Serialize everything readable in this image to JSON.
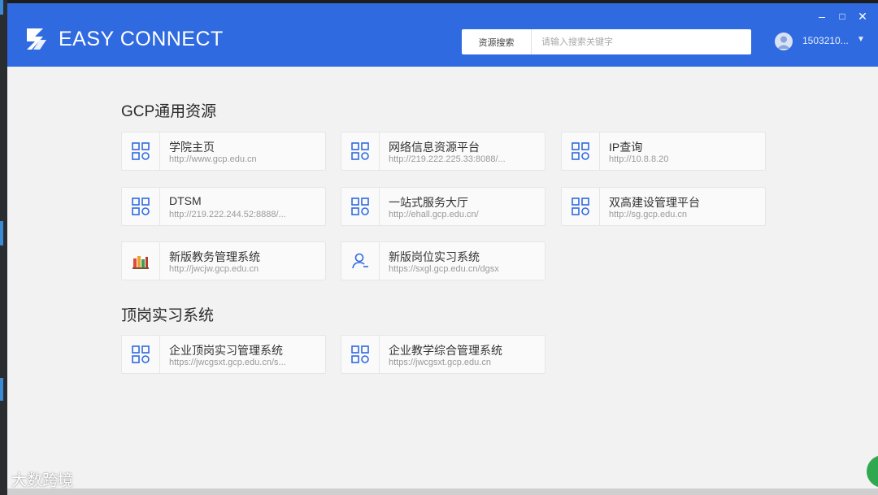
{
  "window": {
    "app_title": "EASY CONNECT",
    "controls": {
      "minimize": "–",
      "maximize": "□",
      "close": "✕"
    }
  },
  "header": {
    "search_type": "资源搜索",
    "search_placeholder": "请输入搜索关键字",
    "user_name": "1503210...",
    "caret": "▼"
  },
  "sections": [
    {
      "title": "GCP通用资源",
      "cards": [
        {
          "name": "学院主页",
          "url": "http://www.gcp.edu.cn",
          "icon": "grid-app-icon"
        },
        {
          "name": "网络信息资源平台",
          "url": "http://219.222.225.33:8088/...",
          "icon": "grid-app-icon"
        },
        {
          "name": "IP查询",
          "url": "http://10.8.8.20",
          "icon": "grid-app-icon"
        },
        {
          "name": "DTSM",
          "url": "http://219.222.244.52:8888/...",
          "icon": "grid-app-icon"
        },
        {
          "name": "一站式服务大厅",
          "url": "http://ehall.gcp.edu.cn/",
          "icon": "grid-app-icon"
        },
        {
          "name": "双高建设管理平台",
          "url": "http://sg.gcp.edu.cn",
          "icon": "grid-app-icon"
        },
        {
          "name": "新版教务管理系统",
          "url": "http://jwcjw.gcp.edu.cn",
          "icon": "books-icon"
        },
        {
          "name": "新版岗位实习系统",
          "url": "https://sxgl.gcp.edu.cn/dgsx",
          "icon": "person-icon"
        }
      ]
    },
    {
      "title": "顶岗实习系统",
      "cards": [
        {
          "name": "企业顶岗实习管理系统",
          "url": "https://jwcgsxt.gcp.edu.cn/s...",
          "icon": "grid-app-icon"
        },
        {
          "name": "企业教学综合管理系统",
          "url": "https://jwcgsxt.gcp.edu.cn",
          "icon": "grid-app-icon"
        }
      ]
    }
  ],
  "watermark": "大数跨境",
  "colors": {
    "header_blue": "#2f6ae0",
    "icon_blue": "#2f6ae0",
    "background": "#f2f2f2"
  }
}
